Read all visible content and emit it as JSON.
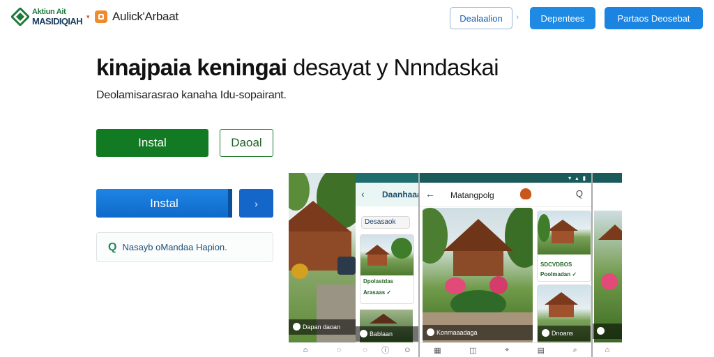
{
  "header": {
    "logo_line1": "Aktiun Ait",
    "logo_line2": "MASIDIQIAH",
    "logo_small": "▾",
    "brand_name": "Aulick'Arbaat",
    "nav_button_outline": "Dealaalion",
    "nav_button_outline_chevron": "›",
    "nav_button_primary": "Depentees",
    "nav_button_primary_wide": "Partaos Deosebat"
  },
  "hero": {
    "title_bold": "kinajpaia keningai",
    "title_light": "desayat y Nnndaskai",
    "subtitle": "Deolamisarasrao kanaha Idu-sopairant."
  },
  "actions": {
    "install_green": "Instal",
    "read_button": "Daoal",
    "install_blue": "Instal",
    "arrow": "›",
    "search_icon": "Q",
    "search_text": "Nasayb oMandaa Hapion."
  },
  "screens": {
    "shot1_caption": "Dapan daoan",
    "shot2_title": "Daanhaaa",
    "shot2_back": "‹",
    "shot2_chip": "Desasaok",
    "shot2_card_line1": "Dpolastdas",
    "shot2_card_line2": "Arasaas ✓",
    "shot2_caption": "Bablaan",
    "shot3_back": "←",
    "shot3_title": "Matangpolg",
    "shot3_search": "Q",
    "shot3_main_caption": "Konmaaadaga",
    "shot3_side_line1": "SDCVDBOS",
    "shot3_side_line2": "Poolmadan ✓",
    "shot3_side_caption": "Dnoans",
    "status_icons": "▾ ▴ ▮"
  },
  "colors": {
    "green_primary": "#127a23",
    "blue_primary": "#1e84e4",
    "blue_nav": "#1a84e0",
    "accent_orange": "#f08a2c",
    "status_bar": "#1a5a5a"
  }
}
